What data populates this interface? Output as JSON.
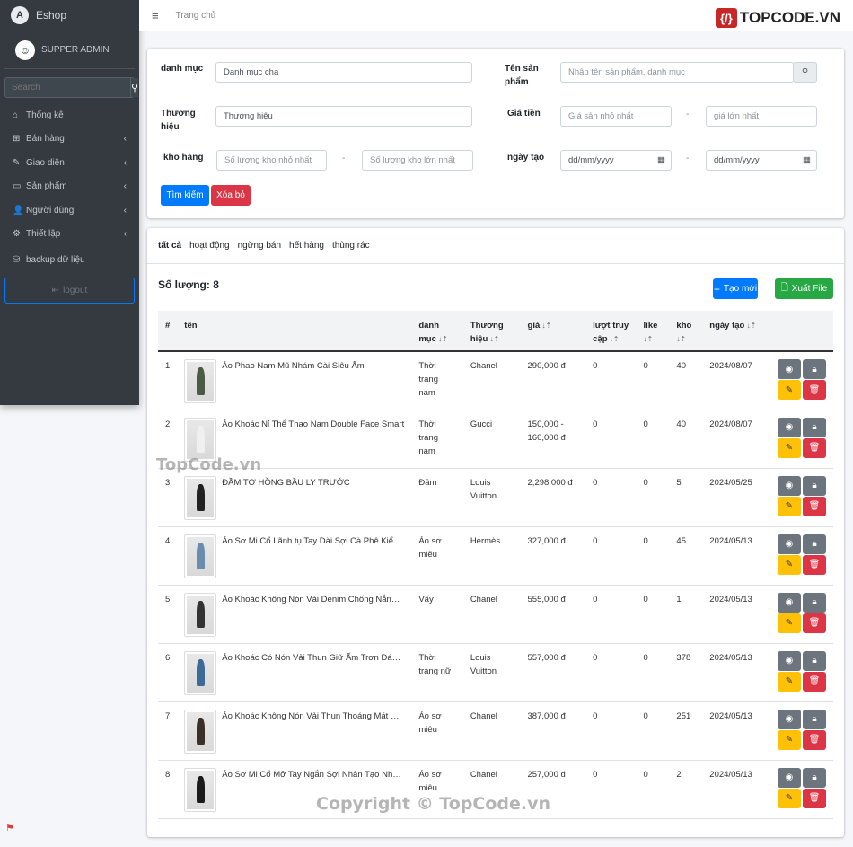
{
  "sidebar": {
    "brand": "Eshop",
    "user": "SUPPER ADMIN",
    "search_placeholder": "Search",
    "items": [
      {
        "label": "Thống kê",
        "icon": "home-icon",
        "g": "⌂",
        "sub": false
      },
      {
        "label": "Bán hàng",
        "icon": "shopping-bag-icon",
        "g": "⊞",
        "sub": true
      },
      {
        "label": "Giao diện",
        "icon": "brush-icon",
        "g": "✎",
        "sub": true
      },
      {
        "label": "Sản phẩm",
        "icon": "box-icon",
        "g": "▭",
        "sub": true
      },
      {
        "label": "Người dùng",
        "icon": "user-icon",
        "g": "👤",
        "sub": true
      },
      {
        "label": "Thiết lập",
        "icon": "gear-icon",
        "g": "⚙",
        "sub": true
      },
      {
        "label": "backup dữ liệu",
        "icon": "backup-icon",
        "g": "⛁",
        "sub": false
      }
    ],
    "logout": "logout"
  },
  "topbar": {
    "breadcrumb": "Trang chủ",
    "logo": "TOPCODE.VN"
  },
  "filter": {
    "category_label": "danh mục",
    "category_value": "Danh mục cha",
    "name_label": "Tên sản phẩm",
    "name_placeholder": "Nhập tên sản phẩm, danh mục",
    "brand_label": "Thương hiệu",
    "brand_value": "Thương hiệu",
    "price_label": "Giá tiền",
    "price_min_placeholder": "Giá sản nhỏ nhất",
    "price_max_placeholder": "giá lớn nhất",
    "stock_label": "kho hàng",
    "stock_min_placeholder": "Số lượng kho nhỏ nhất",
    "stock_max_placeholder": "Số lượng kho lớn nhất",
    "date_label": "ngày tạo",
    "date_placeholder": "dd/mm/yyyy",
    "search_button": "Tìm kiếm",
    "clear_button": "Xóa bỏ"
  },
  "list": {
    "tabs": [
      "tất cả",
      "hoạt động",
      "ngừng bán",
      "hết hàng",
      "thùng rác"
    ],
    "count": "Số lượng: 8",
    "create_button": "Tạo mới",
    "export_button": "Xuất File",
    "headers": [
      "#",
      "tên",
      "danh mục",
      "Thương hiệu",
      "giá",
      "lượt truy cập",
      "like",
      "kho",
      "ngày tạo"
    ],
    "rows": [
      {
        "id": "1",
        "name": "Áo Phao Nam Mũ Nhám Cài Siêu Ấm",
        "category": "Thời trang nam",
        "brand": "Chanel",
        "price": "290,000 đ",
        "views": "0",
        "likes": "0",
        "stock": "40",
        "date": "2024/08/07",
        "color": "#4a5a45"
      },
      {
        "id": "2",
        "name": "Áo Khoác Nỉ Thể Thao Nam Double Face Smart",
        "category": "Thời trang nam",
        "brand": "Gucci",
        "price": "150,000 - 160,000 đ",
        "views": "0",
        "likes": "0",
        "stock": "40",
        "date": "2024/08/07",
        "color": "#f0f0f0"
      },
      {
        "id": "3",
        "name": "ĐẦM TƠ HỒNG BẦU LY TRƯỚC",
        "category": "Đầm",
        "brand": "Louis Vuitton",
        "price": "2,298,000 đ",
        "views": "0",
        "likes": "0",
        "stock": "5",
        "date": "2024/05/25",
        "color": "#222"
      },
      {
        "id": "4",
        "name": "Áo Sơ Mi Cổ Lãnh tụ Tay Dài Sợi Cà Phê Kiểm So...",
        "category": "Áo sơ miêu",
        "brand": "Hermès",
        "price": "327,000 đ",
        "views": "0",
        "likes": "0",
        "stock": "45",
        "date": "2024/05/13",
        "color": "#6a8caf"
      },
      {
        "id": "5",
        "name": "Áo Khoác Không Nón Vải Denim Chống Nắng Ph...",
        "category": "Vấy",
        "brand": "Chanel",
        "price": "555,000 đ",
        "views": "0",
        "likes": "0",
        "stock": "1",
        "date": "2024/05/13",
        "color": "#333"
      },
      {
        "id": "6",
        "name": "Áo Khoác Có Nón Vải Thun Giữ Ấm Trơn Dáng R...",
        "category": "Thời trang nữ",
        "brand": "Louis Vuitton",
        "price": "557,000 đ",
        "views": "0",
        "likes": "0",
        "stock": "378",
        "date": "2024/05/13",
        "color": "#3d6a96"
      },
      {
        "id": "7",
        "name": "Áo Khoác Không Nón Vải Thun Thoáng Mát Biểu...",
        "category": "Áo sơ miêu",
        "brand": "Chanel",
        "price": "387,000 đ",
        "views": "0",
        "likes": "0",
        "stock": "251",
        "date": "2024/05/13",
        "color": "#3a3028"
      },
      {
        "id": "8",
        "name": "Áo Sơ Mi Cổ Mở Tay Ngắn Sợi Nhân Tạo Nhanh ...",
        "category": "Áo sơ miêu",
        "brand": "Chanel",
        "price": "257,000 đ",
        "views": "0",
        "likes": "0",
        "stock": "2",
        "date": "2024/05/13",
        "color": "#1a1a1a"
      }
    ]
  },
  "watermarks": {
    "mid": "TopCode.vn",
    "bottom": "Copyright © TopCode.vn"
  },
  "colors": {
    "primary": "#007bff",
    "danger": "#dc3545",
    "success": "#28a745",
    "warning": "#ffc107",
    "secondary": "#6c757d",
    "sidebar": "#343a40"
  }
}
